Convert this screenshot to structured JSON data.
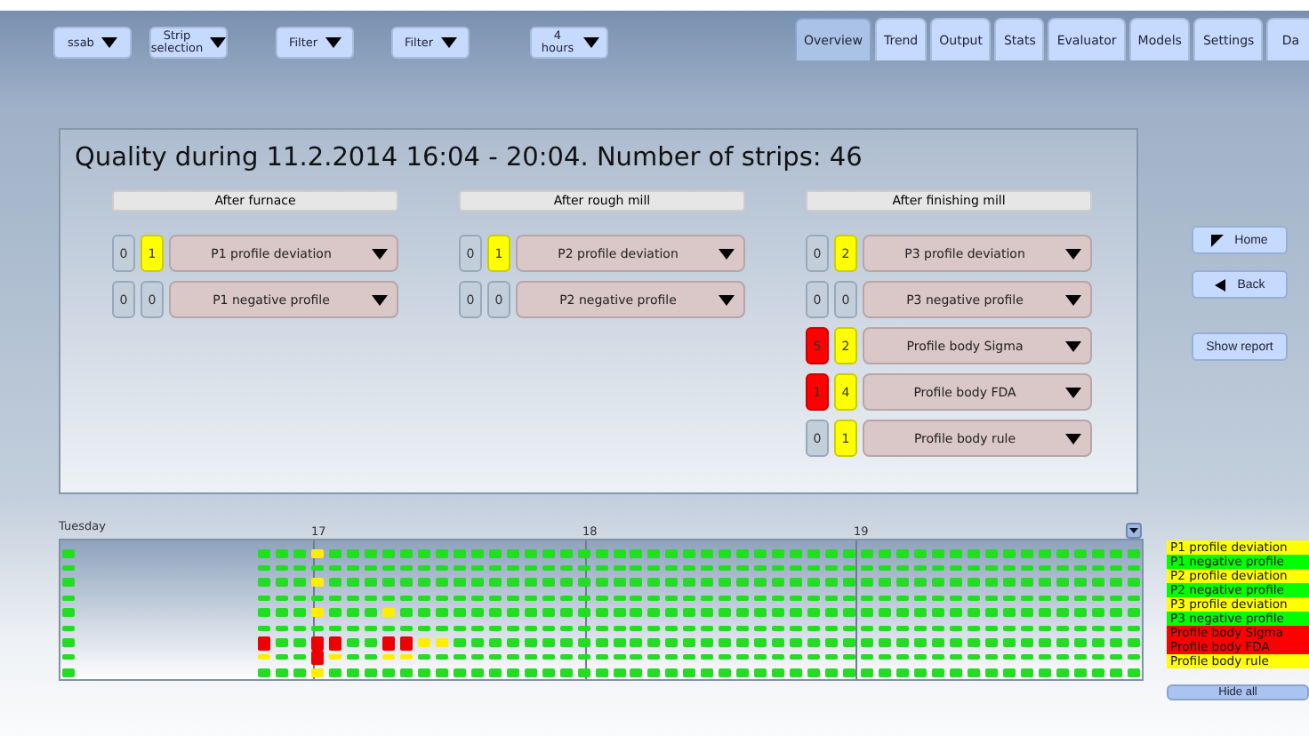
{
  "toolbar": {
    "dropdowns": [
      {
        "label": "ssab"
      },
      {
        "label": "Strip selection"
      },
      {
        "label": "Filter"
      },
      {
        "label": "Filter"
      },
      {
        "label": "4 hours"
      }
    ]
  },
  "tabs": [
    {
      "label": "Overview",
      "selected": true
    },
    {
      "label": "Trend",
      "selected": false
    },
    {
      "label": "Output",
      "selected": false
    },
    {
      "label": "Stats",
      "selected": false
    },
    {
      "label": "Evaluator",
      "selected": false
    },
    {
      "label": "Models",
      "selected": false
    },
    {
      "label": "Settings",
      "selected": false
    },
    {
      "label": "Da",
      "selected": false
    }
  ],
  "quality_panel": {
    "title": "Quality during 11.2.2014 16:04 - 20:04. Number of strips: 46",
    "sections": [
      {
        "heading": "After furnace",
        "rows": [
          {
            "alarms": "0",
            "warnings": "1",
            "measure": "P1 profile deviation"
          },
          {
            "alarms": "0",
            "warnings": "0",
            "measure": "P1 negative profile"
          }
        ]
      },
      {
        "heading": "After rough mill",
        "rows": [
          {
            "alarms": "0",
            "warnings": "1",
            "measure": "P2 profile deviation"
          },
          {
            "alarms": "0",
            "warnings": "0",
            "measure": "P2 negative profile"
          }
        ]
      },
      {
        "heading": "After finishing mill",
        "rows": [
          {
            "alarms": "0",
            "warnings": "2",
            "measure": "P3 profile deviation"
          },
          {
            "alarms": "0",
            "warnings": "0",
            "measure": "P3 negative profile"
          },
          {
            "alarms": "5",
            "warnings": "2",
            "measure": "Profile body Sigma"
          },
          {
            "alarms": "1",
            "warnings": "4",
            "measure": "Profile body FDA"
          },
          {
            "alarms": "0",
            "warnings": "1",
            "measure": "Profile body rule"
          }
        ]
      }
    ]
  },
  "side_buttons": [
    {
      "label": "Home",
      "kind": "home"
    },
    {
      "label": "Back",
      "kind": "back"
    },
    {
      "label": "Show report",
      "kind": "plain"
    }
  ],
  "timeline": {
    "day": "Tuesday",
    "hours": [
      "17",
      "18",
      "19"
    ],
    "strip_columns": [
      {
        "kind": "ok"
      },
      {
        "kind": "gap"
      },
      {
        "kind": "gap"
      },
      {
        "kind": "gap"
      },
      {
        "kind": "gap"
      },
      {
        "kind": "gap"
      },
      {
        "kind": "gap"
      },
      {
        "kind": "gap"
      },
      {
        "kind": "gap"
      },
      {
        "kind": "gap"
      },
      {
        "kind": "gap"
      },
      {
        "kind": "mixed",
        "cells": [
          {
            "kind": "ok"
          },
          {
            "kind": "ok"
          },
          {
            "kind": "ok"
          },
          {
            "kind": "ok"
          },
          {
            "kind": "ok"
          },
          {
            "kind": "ok"
          },
          {
            "kind": "alarm"
          },
          {
            "kind": "warning"
          },
          {
            "kind": "ok"
          }
        ]
      },
      {
        "kind": "ok"
      },
      {
        "kind": "ok"
      },
      {
        "kind": "mixed",
        "cells": [
          {
            "kind": "warning"
          },
          {
            "kind": "ok"
          },
          {
            "kind": "warning"
          },
          {
            "kind": "ok"
          },
          {
            "kind": "warning"
          },
          {
            "kind": "ok"
          },
          {
            "kind": "alarm"
          },
          {
            "kind": "alarm"
          },
          {
            "kind": "warning"
          }
        ]
      },
      {
        "kind": "mixed",
        "cells": [
          {
            "kind": "ok"
          },
          {
            "kind": "ok"
          },
          {
            "kind": "ok"
          },
          {
            "kind": "ok"
          },
          {
            "kind": "ok"
          },
          {
            "kind": "ok"
          },
          {
            "kind": "alarm"
          },
          {
            "kind": "warning"
          },
          {
            "kind": "ok"
          }
        ]
      },
      {
        "kind": "ok"
      },
      {
        "kind": "ok"
      },
      {
        "kind": "mixed",
        "cells": [
          {
            "kind": "ok"
          },
          {
            "kind": "ok"
          },
          {
            "kind": "ok"
          },
          {
            "kind": "ok"
          },
          {
            "kind": "warning"
          },
          {
            "kind": "ok"
          },
          {
            "kind": "alarm"
          },
          {
            "kind": "warning"
          },
          {
            "kind": "ok"
          }
        ]
      },
      {
        "kind": "mixed",
        "cells": [
          {
            "kind": "ok"
          },
          {
            "kind": "ok"
          },
          {
            "kind": "ok"
          },
          {
            "kind": "ok"
          },
          {
            "kind": "ok"
          },
          {
            "kind": "ok"
          },
          {
            "kind": "alarm"
          },
          {
            "kind": "warning"
          },
          {
            "kind": "ok"
          }
        ]
      },
      {
        "kind": "mixed",
        "cells": [
          {
            "kind": "ok"
          },
          {
            "kind": "ok"
          },
          {
            "kind": "ok"
          },
          {
            "kind": "ok"
          },
          {
            "kind": "ok"
          },
          {
            "kind": "ok"
          },
          {
            "kind": "warning"
          },
          {
            "kind": "ok"
          },
          {
            "kind": "ok"
          }
        ]
      },
      {
        "kind": "mixed",
        "cells": [
          {
            "kind": "ok"
          },
          {
            "kind": "ok"
          },
          {
            "kind": "ok"
          },
          {
            "kind": "ok"
          },
          {
            "kind": "ok"
          },
          {
            "kind": "ok"
          },
          {
            "kind": "warning"
          },
          {
            "kind": "ok"
          },
          {
            "kind": "ok"
          }
        ]
      },
      {
        "kind": "ok"
      },
      {
        "kind": "ok"
      },
      {
        "kind": "ok"
      },
      {
        "kind": "ok"
      },
      {
        "kind": "ok"
      },
      {
        "kind": "ok"
      },
      {
        "kind": "ok"
      },
      {
        "kind": "ok"
      },
      {
        "kind": "ok"
      },
      {
        "kind": "ok"
      },
      {
        "kind": "ok"
      },
      {
        "kind": "ok"
      },
      {
        "kind": "ok"
      },
      {
        "kind": "ok"
      },
      {
        "kind": "ok"
      },
      {
        "kind": "ok"
      },
      {
        "kind": "ok"
      },
      {
        "kind": "ok"
      },
      {
        "kind": "ok"
      },
      {
        "kind": "ok"
      },
      {
        "kind": "ok"
      },
      {
        "kind": "ok"
      },
      {
        "kind": "ok"
      },
      {
        "kind": "ok"
      },
      {
        "kind": "ok"
      },
      {
        "kind": "ok"
      },
      {
        "kind": "ok"
      },
      {
        "kind": "ok"
      },
      {
        "kind": "ok"
      },
      {
        "kind": "ok"
      },
      {
        "kind": "ok"
      },
      {
        "kind": "ok"
      },
      {
        "kind": "ok"
      },
      {
        "kind": "ok"
      },
      {
        "kind": "ok"
      },
      {
        "kind": "ok"
      },
      {
        "kind": "ok"
      },
      {
        "kind": "ok"
      },
      {
        "kind": "ok"
      }
    ],
    "legend": [
      {
        "label": "P1 profile deviation",
        "color": "#ffff00"
      },
      {
        "label": "P1 negative profile",
        "color": "#00ff00"
      },
      {
        "label": "P2 profile deviation",
        "color": "#ffff00"
      },
      {
        "label": "P2 negative profile",
        "color": "#00ff00"
      },
      {
        "label": "P3 profile deviation",
        "color": "#ffff00"
      },
      {
        "label": "P3 negative profile",
        "color": "#00ff00"
      },
      {
        "label": "Profile body Sigma",
        "color": "#ff0000"
      },
      {
        "label": "Profile body FDA",
        "color": "#ff0000"
      },
      {
        "label": "Profile body rule",
        "color": "#ffff00"
      }
    ],
    "hide_button": "Hide all"
  }
}
